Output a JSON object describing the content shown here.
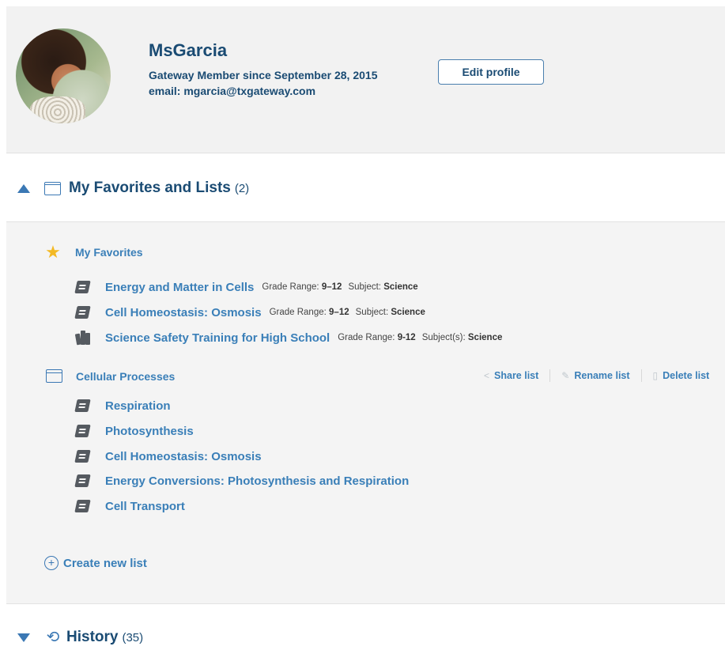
{
  "profile": {
    "name": "MsGarcia",
    "member_since": "Gateway Member since September 28, 2015",
    "email": "email: mgarcia@txgateway.com",
    "edit_label": "Edit profile"
  },
  "favorites_section": {
    "title": "My Favorites and Lists",
    "count": "(2)",
    "expanded": true
  },
  "my_favorites": {
    "title": "My Favorites",
    "items": [
      {
        "title": "Energy and Matter in Cells",
        "grade_label": "Grade Range:",
        "grade": "9–12",
        "subject_label": "Subject:",
        "subject": "Science",
        "icon": "book-icon"
      },
      {
        "title": "Cell Homeostasis: Osmosis",
        "grade_label": "Grade Range:",
        "grade": "9–12",
        "subject_label": "Subject:",
        "subject": "Science",
        "icon": "book-icon"
      },
      {
        "title": "Science Safety Training for High School",
        "grade_label": "Grade Range:",
        "grade": "9-12",
        "subject_label": "Subject(s):",
        "subject": "Science",
        "icon": "books-icon"
      }
    ]
  },
  "cellular_list": {
    "title": "Cellular Processes",
    "share_label": "Share list",
    "rename_label": "Rename list",
    "delete_label": "Delete list",
    "items": [
      {
        "title": "Respiration"
      },
      {
        "title": "Photosynthesis"
      },
      {
        "title": "Cell Homeostasis: Osmosis"
      },
      {
        "title": "Energy Conversions: Photosynthesis and Respiration"
      },
      {
        "title": "Cell Transport"
      }
    ]
  },
  "create_list_label": "Create new list",
  "history_section": {
    "title": "History",
    "count": "(35)",
    "expanded": false
  },
  "colors": {
    "accent": "#3a7fb8",
    "heading": "#1a4b73",
    "star": "#f3b924",
    "panel": "#f4f4f4"
  }
}
